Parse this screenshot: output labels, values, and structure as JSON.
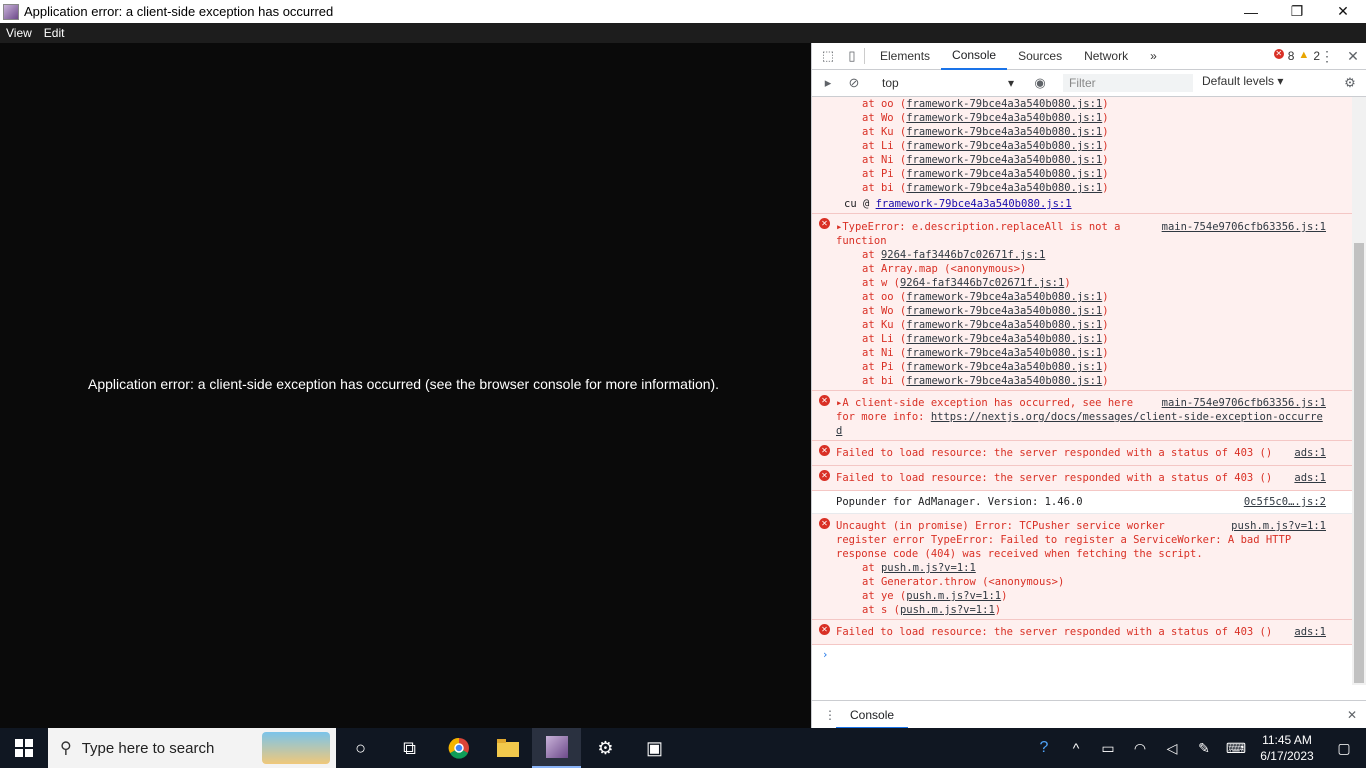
{
  "window": {
    "title": "Application error: a client-side exception has occurred",
    "minimize": "—",
    "restore": "❐",
    "close": "✕"
  },
  "menu": [
    "View",
    "Edit"
  ],
  "page": {
    "message": "Application error: a client-side exception has occurred (see the browser console for more information)."
  },
  "devtools": {
    "tabs": [
      "Elements",
      "Console",
      "Sources",
      "Network"
    ],
    "more": "»",
    "error_count": "8",
    "warning_count": "2",
    "context": "top",
    "filter_placeholder": "Filter",
    "levels": "Default levels ▾",
    "drawer_tab": "Console"
  },
  "console": {
    "top_stack": [
      {
        "fn": "at oo (",
        "link": "framework-79bce4a3a540b080.js:1",
        "end": ")"
      },
      {
        "fn": "at Wo (",
        "link": "framework-79bce4a3a540b080.js:1",
        "end": ")"
      },
      {
        "fn": "at Ku (",
        "link": "framework-79bce4a3a540b080.js:1",
        "end": ")"
      },
      {
        "fn": "at Li (",
        "link": "framework-79bce4a3a540b080.js:1",
        "end": ")"
      },
      {
        "fn": "at Ni (",
        "link": "framework-79bce4a3a540b080.js:1",
        "end": ")"
      },
      {
        "fn": "at Pi (",
        "link": "framework-79bce4a3a540b080.js:1",
        "end": ")"
      },
      {
        "fn": "at bi (",
        "link": "framework-79bce4a3a540b080.js:1",
        "end": ")"
      }
    ],
    "cu_line": "cu @ ",
    "cu_link": "framework-79bce4a3a540b080.js:1",
    "m1": {
      "text": "▸TypeError: e.description.replaceAll is not a function",
      "src": "main-754e9706cfb63356.js:1",
      "stack": [
        {
          "fn": "at ",
          "link": "9264-faf3446b7c02671f.js:1",
          "end": ""
        },
        {
          "fn": "at Array.map (<anonymous>)",
          "link": "",
          "end": ""
        },
        {
          "fn": "at w (",
          "link": "9264-faf3446b7c02671f.js:1",
          "end": ")"
        },
        {
          "fn": "at oo (",
          "link": "framework-79bce4a3a540b080.js:1",
          "end": ")"
        },
        {
          "fn": "at Wo (",
          "link": "framework-79bce4a3a540b080.js:1",
          "end": ")"
        },
        {
          "fn": "at Ku (",
          "link": "framework-79bce4a3a540b080.js:1",
          "end": ")"
        },
        {
          "fn": "at Li (",
          "link": "framework-79bce4a3a540b080.js:1",
          "end": ")"
        },
        {
          "fn": "at Ni (",
          "link": "framework-79bce4a3a540b080.js:1",
          "end": ")"
        },
        {
          "fn": "at Pi (",
          "link": "framework-79bce4a3a540b080.js:1",
          "end": ")"
        },
        {
          "fn": "at bi (",
          "link": "framework-79bce4a3a540b080.js:1",
          "end": ")"
        }
      ]
    },
    "m2": {
      "text": "▸A client-side exception has occurred, see here for more info: ",
      "link": "https://nextjs.org/docs/messages/client-side-exception-occurred",
      "src": "main-754e9706cfb63356.js:1"
    },
    "m3": {
      "text": "Failed to load resource: the server responded with a status of 403 ()",
      "src": "ads:1"
    },
    "m4": {
      "text": "Failed to load resource: the server responded with a status of 403 ()",
      "src": "ads:1"
    },
    "m5": {
      "text": "Popunder for AdManager. Version: 1.46.0",
      "src": "0c5f5c0….js:2"
    },
    "m6": {
      "text": "Uncaught (in promise) Error: TCPusher service worker register error TypeError: Failed to register a ServiceWorker: A bad HTTP response code (404) was received when fetching the script.",
      "src": "push.m.js?v=1:1",
      "stack": [
        {
          "fn": "at ",
          "link": "push.m.js?v=1:1",
          "end": ""
        },
        {
          "fn": "at Generator.throw (<anonymous>)",
          "link": "",
          "end": ""
        },
        {
          "fn": "at ye (",
          "link": "push.m.js?v=1:1",
          "end": ")"
        },
        {
          "fn": "at s (",
          "link": "push.m.js?v=1:1",
          "end": ")"
        }
      ]
    },
    "m7": {
      "text": "Failed to load resource: the server responded with a status of 403 ()",
      "src": "ads:1"
    },
    "prompt": "›"
  },
  "taskbar": {
    "search_placeholder": "Type here to search",
    "time": "11:45 AM",
    "date": "6/17/2023"
  }
}
